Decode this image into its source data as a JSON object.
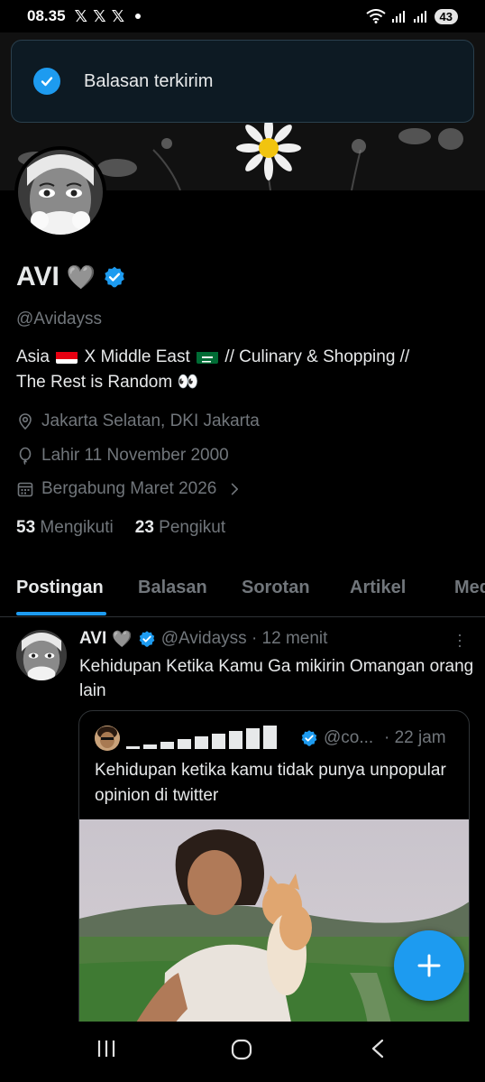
{
  "status_bar": {
    "time": "08.35",
    "x_icons": [
      "𝕏",
      "𝕏",
      "𝕏"
    ],
    "battery": "43"
  },
  "toast": {
    "icon": "check-icon",
    "text": "Balasan terkirim"
  },
  "profile": {
    "name": "AVI",
    "heart": "🩶",
    "handle": "@Avidayss",
    "bio_line1_a": "Asia",
    "bio_line1_b": "X Middle East",
    "bio_line1_c": "// Culinary & Shopping //",
    "bio_line2": "The Rest is Random",
    "bio_emoji": "👀",
    "location": "Jakarta Selatan, DKI Jakarta",
    "birthday": "Lahir 11 November 2000",
    "joined": "Bergabung Maret 2026",
    "following_count": "53",
    "following_label": "Mengikuti",
    "followers_count": "23",
    "followers_label": "Pengikut"
  },
  "tabs": [
    {
      "label": "Postingan",
      "active": true
    },
    {
      "label": "Balasan",
      "active": false
    },
    {
      "label": "Sorotan",
      "active": false
    },
    {
      "label": "Artikel",
      "active": false
    },
    {
      "label": "Media",
      "active": false
    }
  ],
  "post": {
    "name": "AVI",
    "heart": "🩶",
    "handle_time": "@Avidayss · 12 menit",
    "text": "Kehidupan Ketika Kamu Ga mikirin Omangan orang lain",
    "quote": {
      "handle": "@co...",
      "time": "· 22 jam",
      "text": "Kehidupan ketika kamu tidak punya unpopular opinion di twitter"
    }
  },
  "colors": {
    "accent": "#1d9bf0",
    "background": "#000000",
    "text_primary": "#e7e9ea",
    "text_secondary": "#71767b",
    "border": "#2f3336"
  }
}
